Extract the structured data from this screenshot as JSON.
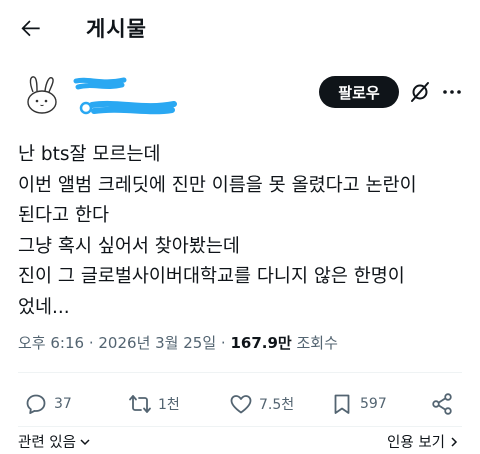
{
  "header": {
    "title": "게시물"
  },
  "author": {
    "follow_label": "팔로우"
  },
  "post": {
    "lines": [
      "난 bts잘 모르는데",
      "이번 앨범 크레딧에 진만 이름을 못 올렸다고 논란이",
      "된다고 한다",
      "그냥 혹시 싶어서 찾아봤는데",
      "진이 그 글로벌사이버대학교를 다니지 않은 한명이",
      "었네..."
    ],
    "time": "오후 6:16",
    "date": "2026년 3월 25일",
    "views": "167.9만",
    "views_label": "조회수"
  },
  "actions": {
    "replies": "37",
    "reposts": "1천",
    "likes": "7.5천",
    "bookmarks": "597"
  },
  "footer": {
    "related_label": "관련 있음",
    "quote_label": "인용 보기"
  },
  "colors": {
    "primary": "#0f1419",
    "secondary": "#536471",
    "divider": "#eff3f4",
    "scribble": "#2aa8f2"
  },
  "icons": [
    "back-arrow-icon",
    "grok-icon",
    "more-icon",
    "reply-icon",
    "repost-icon",
    "like-icon",
    "bookmark-icon",
    "share-icon",
    "chevron-down-icon",
    "chevron-right-icon"
  ]
}
